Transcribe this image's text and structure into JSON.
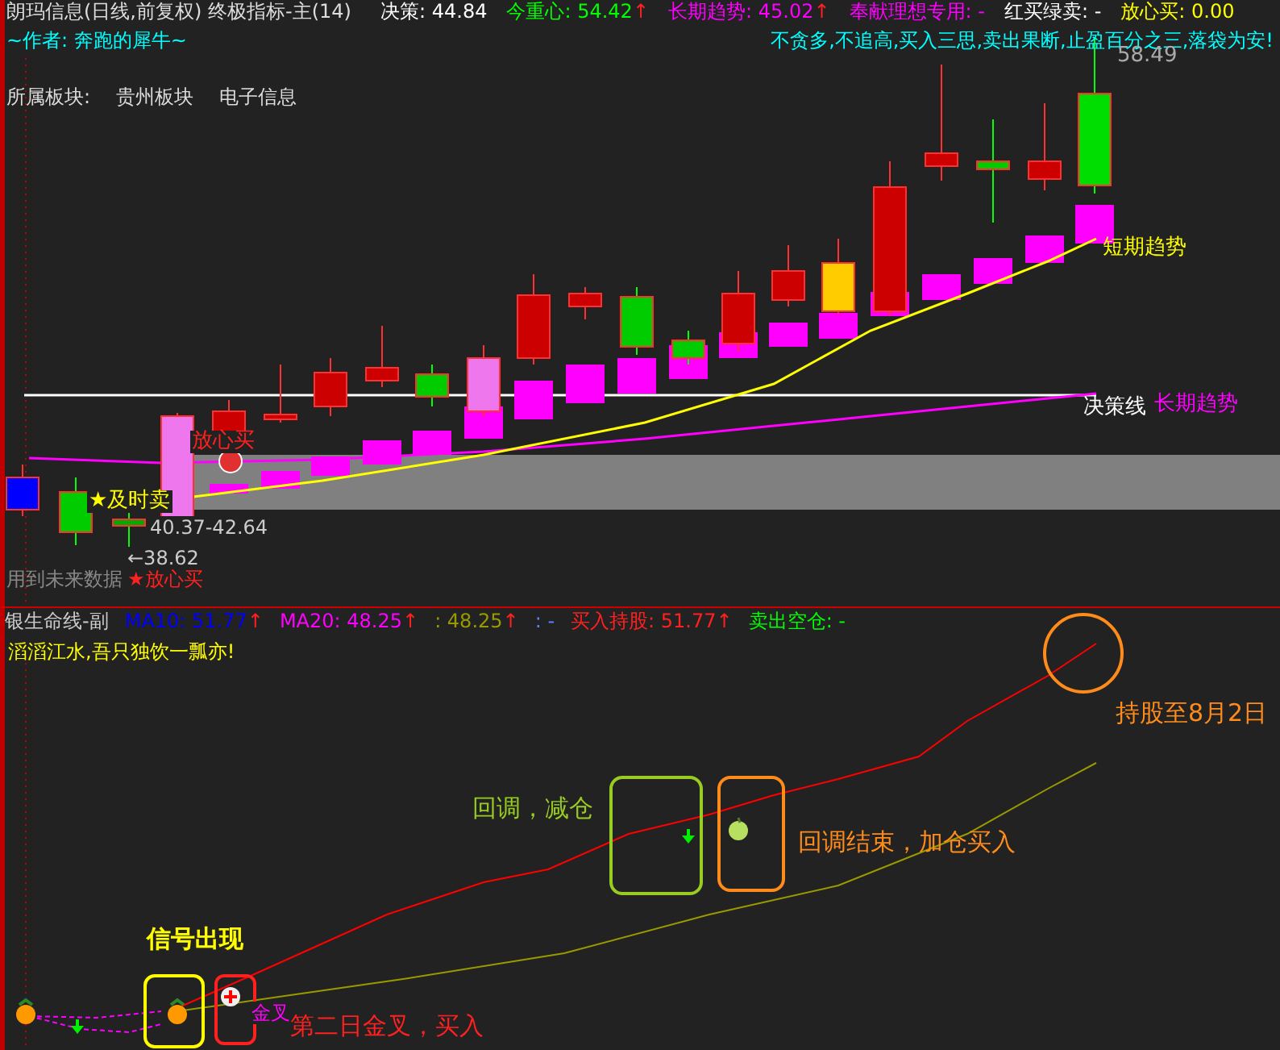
{
  "main_panel": {
    "title": "朗玛信息(日线,前复权) 终极指标-主(14)",
    "indicators": [
      {
        "text": "决策: 44.84",
        "color": "#ffffff"
      },
      {
        "text": "今重心: 54.42",
        "arrow": "↑",
        "color": "#00ff00"
      },
      {
        "text": "长期趋势: 45.02",
        "arrow": "↑",
        "color": "#ff00ff"
      },
      {
        "text": "奉献理想专用: -",
        "color": "#ff00ff"
      },
      {
        "text": "红买绿卖: -",
        "color": "#ffffff"
      },
      {
        "text": "放心买: 0.00",
        "color": "#ffff00"
      }
    ],
    "author": "~作者: 奔跑的犀牛~",
    "slogan": "不贪多,不追高,买入三思,卖出果断,止盈百分之三,落袋为安!",
    "sector_label": "所属板块:",
    "sectors": [
      "贵州板块",
      "电子信息"
    ],
    "chart_labels": [
      "58.49",
      "短期趋势",
      "决策线",
      "长期趋势",
      "放心买",
      "★及时卖",
      "40.37-42.64",
      "←38.62",
      "用到未来数据",
      "★放心买"
    ]
  },
  "sub_panel": {
    "title": "银生命线-副",
    "indicators": [
      {
        "text": "MA10: 51.77",
        "arrow": "↑",
        "color": "#0000ff"
      },
      {
        "text": "MA20: 48.25",
        "arrow": "↑",
        "color": "#ff00ff"
      },
      {
        "text": ": 48.25",
        "arrow": "↑",
        "color": "#999900"
      },
      {
        "text": ": -",
        "color": "#5588ff"
      },
      {
        "text": "买入持股: 51.77",
        "arrow": "↑",
        "color": "#ff2020"
      },
      {
        "text": "卖出空仓: -",
        "color": "#00ff00"
      }
    ],
    "poem": "滔滔江水,吾只独饮一瓢亦!",
    "annotations": [
      "持股至8月2日",
      "回调，减仓",
      "回调结束，加仓买入",
      "信号出现",
      "金叉",
      "第二日金叉，买入"
    ]
  }
}
